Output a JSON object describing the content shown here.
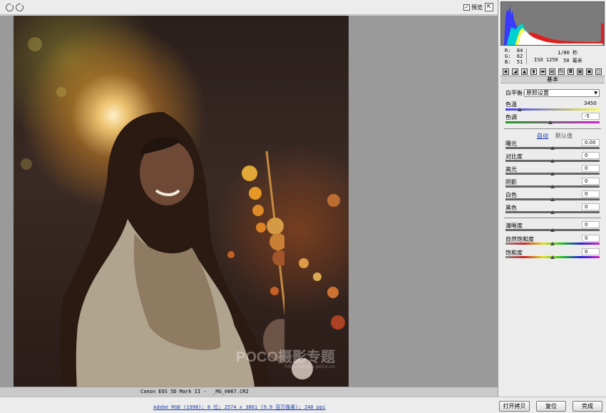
{
  "toolbar": {
    "preview_checked": "✓",
    "preview_label": "预览",
    "fullscreen_glyph": "⇱"
  },
  "icons": [
    "rotate-left-icon",
    "rotate-right-icon",
    "fullscreen-icon",
    "histogram-icon"
  ],
  "status": {
    "camera_info": "Canon EOS 5D Mark II -  _MG_0067.CR2",
    "workflow_options": "Adobe RGB (1998); 8 位; 2574 x 3861 (9.9 百万像素); 240 ppi"
  },
  "buttons": {
    "open_copy": "打开拷贝",
    "reset": "复位",
    "done": "完成"
  },
  "readout": {
    "r_label": "R:",
    "r_value": "84",
    "g_label": "G:",
    "g_value": "62",
    "b_label": "B:",
    "b_value": "51",
    "shutter": "1/80 秒",
    "iso": "ISO 1250",
    "focal": "50 毫米"
  },
  "panel": {
    "section_title": "基本",
    "white_balance_label": "白平衡:",
    "white_balance_value": "原照设置",
    "temperature_label": "色温",
    "temperature_value": "3450",
    "tint_label": "色调",
    "tint_value": "-5",
    "auto_link": "自动",
    "default_link": "默认值",
    "sliders": [
      {
        "label": "曝光",
        "value": "0.00",
        "position": 0.5
      },
      {
        "label": "对比度",
        "value": "0",
        "position": 0.5
      },
      {
        "label": "高光",
        "value": "0",
        "position": 0.5
      },
      {
        "label": "阴影",
        "value": "0",
        "position": 0.5
      },
      {
        "label": "白色",
        "value": "0",
        "position": 0.5
      },
      {
        "label": "黑色",
        "value": "0",
        "position": 0.5
      }
    ],
    "presence_sliders": [
      {
        "label": "清晰度",
        "value": "0",
        "position": 0.5
      },
      {
        "label": "自然饱和度",
        "value": "0",
        "position": 0.5
      },
      {
        "label": "饱和度",
        "value": "0",
        "position": 0.5
      }
    ],
    "temperature_position": 0.15,
    "tint_position": 0.48
  },
  "watermark": {
    "brand": "POCO摄影专题",
    "url": "http://photo.poco.cn"
  }
}
